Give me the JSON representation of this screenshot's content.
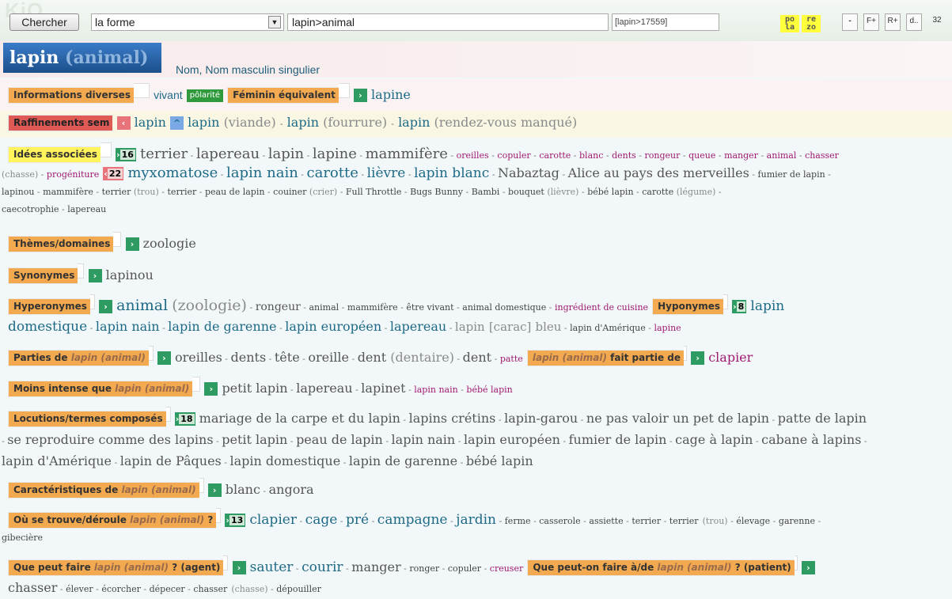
{
  "toolbar": {
    "watermark": "KiO",
    "search_button": "Chercher",
    "mode_select": "la forme",
    "query": "lapin>animal",
    "word_id": "[lapin>17559]",
    "btn1_top": "po",
    "btn1_bottom": "la",
    "btn2_top": "re",
    "btn2_bottom": "zo",
    "minus": "-",
    "f_plus": "F+",
    "r_plus": "R+",
    "d_dots": "d..",
    "three_two": "32"
  },
  "entry": {
    "word": "lapin",
    "sense": "(animal)",
    "pos": "Nom, Nom masculin singulier"
  },
  "sections": {
    "info": {
      "label": "Informations diverses",
      "vivant": "vivant",
      "polarite": "pôlarité",
      "feminin_label": "Féminin équivalent",
      "feminin": "lapine"
    },
    "raff": {
      "label": "Raffinements sem",
      "w1": "lapin",
      "w2": "lapin",
      "w2s": "(viande)",
      "w3": "lapin",
      "w3s": "(fourrure)",
      "w4": "lapin",
      "w4s": "(rendez-vous manqué)"
    },
    "idees": {
      "label": "Idées associées",
      "count1": "16",
      "count2": "22",
      "a": [
        "terrier",
        "lapereau",
        "lapin",
        "lapine",
        "mammifère"
      ],
      "b": [
        "oreilles",
        "copuler",
        "carotte",
        "blanc",
        "dents",
        "rongeur",
        "queue",
        "manger",
        "animal",
        "chasser"
      ],
      "b_chasse": "(chasse)",
      "b_progeniture": "progéniture",
      "c": [
        "myxomatose",
        "lapin nain",
        "carotte",
        "lièvre",
        "lapin blanc",
        "Nabaztag",
        "Alice au pays des merveilles",
        "fumier de lapin"
      ],
      "d": [
        "lapinou",
        "mammifère",
        "terrier",
        "(trou)",
        "terrier",
        "peau de lapin",
        "couiner",
        "(crier)",
        "Full Throttle",
        "Bugs Bunny",
        "Bambi",
        "bouquet",
        "(lièvre)",
        "bébé lapin",
        "carotte",
        "(légume)"
      ],
      "e": [
        "caecotrophie",
        "lapereau"
      ]
    },
    "themes": {
      "label": "Thèmes/domaines",
      "v": "zoologie"
    },
    "syn": {
      "label": "Synonymes",
      "v": "lapinou"
    },
    "hyper": {
      "label": "Hyperonymes",
      "big": "animal",
      "bigs": "(zoologie)",
      "list": [
        "rongeur",
        "animal",
        "mammifère",
        "être vivant",
        "animal domestique"
      ],
      "mag": "ingrédient de cuisine",
      "hypo_label": "Hyponymes",
      "hypo_count": "8",
      "h1": "lapin",
      "h2": "domestique",
      "h3": "lapin nain",
      "h4": "lapin de garenne",
      "h5": "lapin européen",
      "h6": "lapereau",
      "h7": "lapin",
      "h7s": "[carac]",
      "h7b": "bleu",
      "h8": "lapin d'Amérique",
      "h9": "lapine"
    },
    "parties": {
      "label": "Parties de",
      "w": "lapin",
      "s": "(animal)",
      "list": [
        "oreilles",
        "dents",
        "tête",
        "oreille",
        "dent"
      ],
      "dentaire": "(dentaire)",
      "dent2": "dent",
      "patte": "patte",
      "fp_label": "fait partie de",
      "fp": "clapier"
    },
    "moins": {
      "label": "Moins intense que",
      "w": "lapin",
      "s": "(animal)",
      "list": [
        "petit lapin",
        "lapereau",
        "lapinet"
      ],
      "mags": [
        "lapin nain",
        "bébé lapin"
      ]
    },
    "locs": {
      "label": "Locutions/termes composés",
      "count": "18",
      "l1": [
        "mariage de la carpe et du lapin",
        "lapins crétins",
        "lapin-garou",
        "ne pas valoir un pet de lapin",
        "patte de lapin"
      ],
      "l2": [
        "se reproduire comme des lapins",
        "petit lapin",
        "peau de lapin",
        "lapin nain",
        "lapin européen",
        "fumier de lapin",
        "cage à lapin",
        "cabane à lapins"
      ],
      "l3": [
        "lapin d'Amérique",
        "lapin de Pâques",
        "lapin domestique",
        "lapin de garenne",
        "bébé lapin"
      ]
    },
    "carac": {
      "label": "Caractéristiques de",
      "w": "lapin",
      "s": "(animal)",
      "list": [
        "blanc",
        "angora"
      ]
    },
    "ou": {
      "label": "Où se trouve/déroule",
      "w": "lapin",
      "s": "(animal)",
      "q": "?",
      "count": "13",
      "big": [
        "clapier",
        "cage",
        "pré",
        "campagne",
        "jardin"
      ],
      "small": [
        "ferme",
        "casserole",
        "assiette",
        "terrier",
        "terrier",
        "(trou)",
        "élevage",
        "garenne"
      ],
      "last": "gibecière"
    },
    "agent": {
      "label": "Que peut faire",
      "w": "lapin",
      "s": "(animal)",
      "tail": "? (agent)",
      "big": [
        "sauter",
        "courir",
        "manger"
      ],
      "small": [
        "ronger",
        "copuler"
      ],
      "mag": "creuser",
      "p_label": "Que peut-on faire à/de",
      "p_w": "lapin",
      "p_s": "(animal)",
      "p_tail": "? (patient)",
      "p_big": "chasser",
      "p_small": [
        "élever",
        "écorcher",
        "dépecer",
        "chasser"
      ],
      "p_chasse": "(chasse)",
      "p_last": "dépouiller"
    }
  }
}
